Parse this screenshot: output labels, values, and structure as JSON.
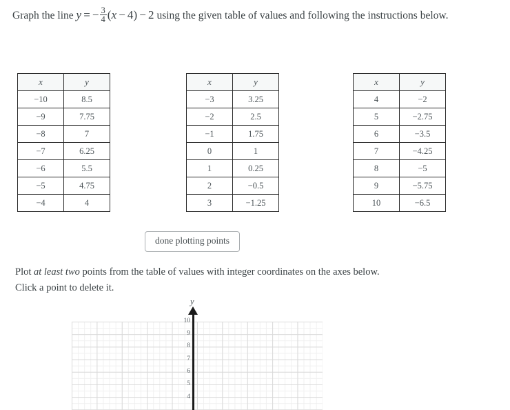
{
  "prompt": {
    "lead": "Graph the line",
    "equation": {
      "lhs": "y",
      "equals": "=",
      "minus": "−",
      "frac_num": "3",
      "frac_den": "4",
      "paren_open": "(",
      "var": "x",
      "inner_minus": "−",
      "inner_num": "4",
      "paren_close": ")",
      "tail_minus": "−",
      "tail_num": "2",
      "plain": "y = −3/4(x − 4) − 2"
    },
    "tail": "using the given table of values and following the instructions below."
  },
  "tables": [
    {
      "id": "table-1",
      "headers": [
        "x",
        "y"
      ],
      "rows": [
        [
          "−10",
          "8.5"
        ],
        [
          "−9",
          "7.75"
        ],
        [
          "−8",
          "7"
        ],
        [
          "−7",
          "6.25"
        ],
        [
          "−6",
          "5.5"
        ],
        [
          "−5",
          "4.75"
        ],
        [
          "−4",
          "4"
        ]
      ]
    },
    {
      "id": "table-2",
      "headers": [
        "x",
        "y"
      ],
      "rows": [
        [
          "−3",
          "3.25"
        ],
        [
          "−2",
          "2.5"
        ],
        [
          "−1",
          "1.75"
        ],
        [
          "0",
          "1"
        ],
        [
          "1",
          "0.25"
        ],
        [
          "2",
          "−0.5"
        ],
        [
          "3",
          "−1.25"
        ]
      ]
    },
    {
      "id": "table-3",
      "headers": [
        "x",
        "y"
      ],
      "rows": [
        [
          "4",
          "−2"
        ],
        [
          "5",
          "−2.75"
        ],
        [
          "6",
          "−3.5"
        ],
        [
          "7",
          "−4.25"
        ],
        [
          "8",
          "−5"
        ],
        [
          "9",
          "−5.75"
        ],
        [
          "10",
          "−6.5"
        ]
      ]
    }
  ],
  "done_button": {
    "label": "done plotting points"
  },
  "instructions": {
    "part1": "Plot ",
    "emphasis": "at least two",
    "part2": " points from the table of values with integer coordinates on the axes below. Click a point to delete it."
  },
  "graph": {
    "axis_label_y": "y",
    "y_ticks": [
      "10",
      "9",
      "8",
      "7",
      "6",
      "5",
      "4"
    ],
    "grid_color": "#d9d9d9",
    "axis_color": "#1a1a1a",
    "plotted_points": []
  }
}
